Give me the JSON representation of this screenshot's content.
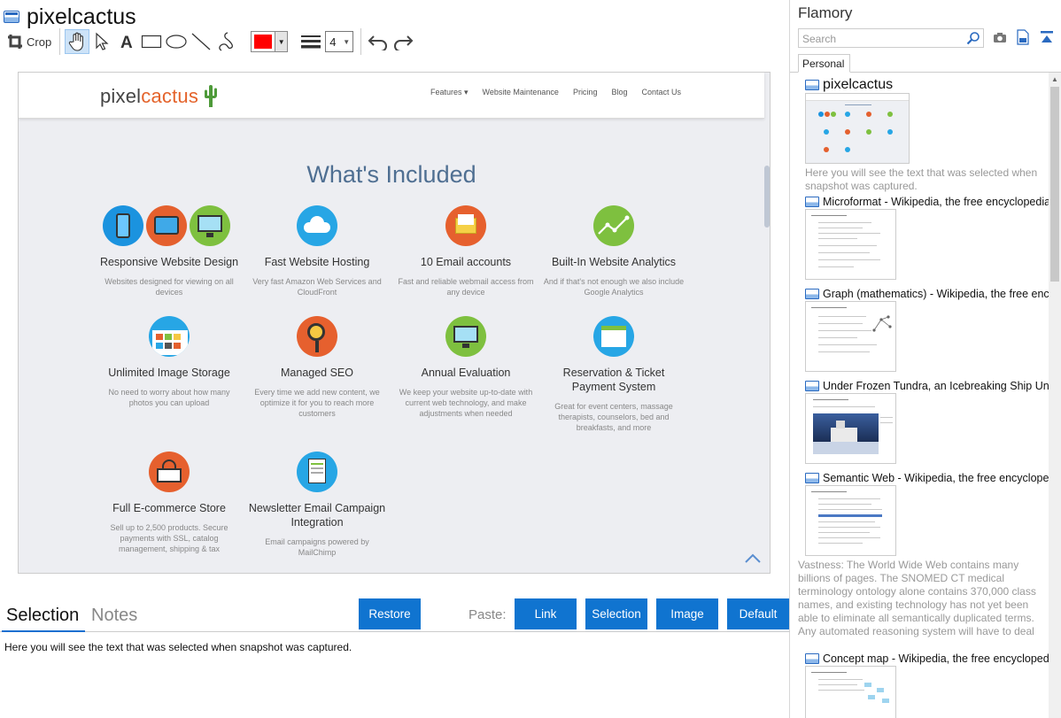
{
  "app": {
    "title": "pixelcactus"
  },
  "toolbar": {
    "crop_label": "Crop",
    "stroke_width": "4",
    "color": "#ff0000"
  },
  "site": {
    "logo_pre": "pixel",
    "logo_post": "cactus",
    "nav": [
      "Features ▾",
      "Website Maintenance",
      "Pricing",
      "Blog",
      "Contact Us"
    ],
    "section_title": "What's Included",
    "features": [
      {
        "title": "Responsive Website Design",
        "desc": "Websites designed for viewing on all devices"
      },
      {
        "title": "Fast Website Hosting",
        "desc": "Very fast Amazon Web Services and CloudFront"
      },
      {
        "title": "10 Email accounts",
        "desc": "Fast and reliable webmail access from any device"
      },
      {
        "title": "Built-In Website Analytics",
        "desc": "And if that's not enough we also include Google Analytics"
      },
      {
        "title": "Unlimited Image Storage",
        "desc": "No need to worry about how many photos you can upload"
      },
      {
        "title": "Managed SEO",
        "desc": "Every time we add new content, we optimize it for you to reach more customers"
      },
      {
        "title": "Annual Evaluation",
        "desc": "We keep your website up-to-date with current web technology, and make adjustments when needed"
      },
      {
        "title": "Reservation & Ticket Payment System",
        "desc": "Great for event centers, massage therapists, counselors, bed and breakfasts, and more"
      },
      {
        "title": "Full E-commerce Store",
        "desc": "Sell up to 2,500 products. Secure payments with SSL, catalog management, shipping & tax"
      },
      {
        "title": "Newsletter Email Campaign Integration",
        "desc": "Email campaigns powered by MailChimp"
      }
    ]
  },
  "bottom": {
    "tab_selection": "Selection",
    "tab_notes": "Notes",
    "restore": "Restore",
    "paste_label": "Paste:",
    "paste_link": "Link",
    "paste_selection": "Selection",
    "paste_image": "Image",
    "paste_default": "Default",
    "selected_text": "Here you will see the text that was selected when snapshot was captured."
  },
  "sidebar": {
    "title": "Flamory",
    "search_placeholder": "Search",
    "tab": "Personal",
    "items": [
      {
        "title": "pixelcactus",
        "desc": "Here you will see the text that was selected when snapshot was captured."
      },
      {
        "title": "Microformat - Wikipedia, the free encyclopedia",
        "desc": ""
      },
      {
        "title": "Graph (mathematics) - Wikipedia, the free encyclopedia",
        "desc": ""
      },
      {
        "title": "Under Frozen Tundra, an Icebreaking Ship Uncovers",
        "desc": ""
      },
      {
        "title": "Semantic Web - Wikipedia, the free encyclopedia",
        "desc": "Vastness: The World Wide Web contains many billions of pages. The SNOMED CT medical terminology ontology alone contains 370,000 class names, and existing technology has not yet been able to eliminate all semantically duplicated terms. Any automated reasoning system will have to deal with truly huge inputs."
      },
      {
        "title": "Concept map - Wikipedia, the free encyclopedia",
        "desc": ""
      }
    ]
  }
}
